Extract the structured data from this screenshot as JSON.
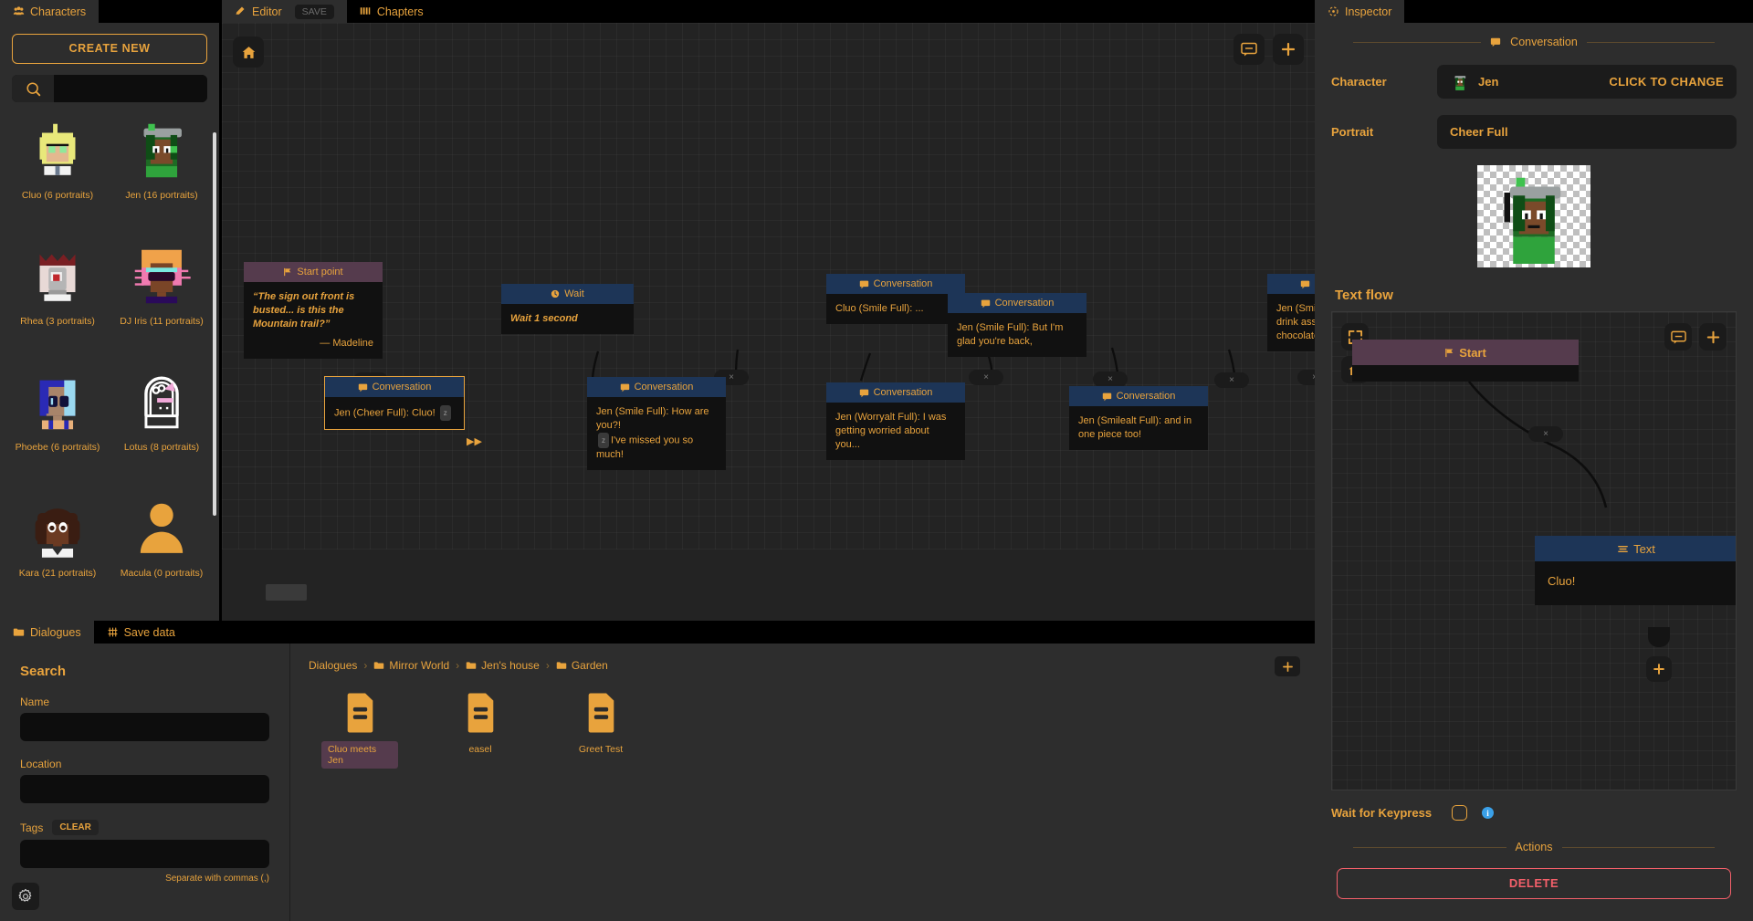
{
  "characters_panel": {
    "tab_label": "Characters",
    "create_new_label": "CREATE NEW",
    "search_placeholder": "",
    "search_value": "",
    "items": [
      {
        "label": "Cluo (6 portraits)",
        "name": "Cluo",
        "portraits": 6,
        "icon": "character-thumb-cluo"
      },
      {
        "label": "Jen (16 portraits)",
        "name": "Jen",
        "portraits": 16,
        "icon": "character-thumb-jen"
      },
      {
        "label": "Rhea (3 portraits)",
        "name": "Rhea",
        "portraits": 3,
        "icon": "character-thumb-rhea"
      },
      {
        "label": "DJ Iris (11 portraits)",
        "name": "DJ Iris",
        "portraits": 11,
        "icon": "character-thumb-dj-iris"
      },
      {
        "label": "Phoebe (6 portraits)",
        "name": "Phoebe",
        "portraits": 6,
        "icon": "character-thumb-phoebe"
      },
      {
        "label": "Lotus (8 portraits)",
        "name": "Lotus",
        "portraits": 8,
        "icon": "character-thumb-lotus"
      },
      {
        "label": "Kara (21 portraits)",
        "name": "Kara",
        "portraits": 21,
        "icon": "character-thumb-kara"
      },
      {
        "label": "Macula (0 portraits)",
        "name": "Macula",
        "portraits": 0,
        "icon": "character-thumb-macula"
      }
    ]
  },
  "editor": {
    "tabs": [
      {
        "label": "Editor",
        "icon": "pencil-icon",
        "active": true
      },
      {
        "label": "Chapters",
        "icon": "columns-icon",
        "active": false
      }
    ],
    "save_label": "SAVE",
    "home_icon": "home-icon",
    "toolbar_icons": [
      "comment-add-icon",
      "plus-icon"
    ],
    "nodes": [
      {
        "type": "Start point",
        "header_icon": "flag-icon",
        "text": "“The sign out front is busted... is this the Mountain trail?”",
        "attribution": "— Madeline",
        "style": "start"
      },
      {
        "type": "Wait",
        "header_icon": "clock-icon",
        "text": "Wait 1 second",
        "style": "wait"
      },
      {
        "type": "Conversation",
        "header_icon": "speech-icon",
        "text": "Jen (Cheer Full): Cluo!",
        "chip": "z",
        "selected": true
      },
      {
        "type": "Conversation",
        "header_icon": "speech-icon",
        "text": "Jen (Smile Full): How are you?!",
        "text2": "I've missed you so much!",
        "chip": "z"
      },
      {
        "type": "Conversation",
        "header_icon": "speech-icon",
        "text": "Cluo (Smile Full): ..."
      },
      {
        "type": "Conversation",
        "header_icon": "speech-icon",
        "text": "Jen (Worryalt Full): I was getting worried about you..."
      },
      {
        "type": "Conversation",
        "header_icon": "speech-icon",
        "text": "Jen (Smile Full): But I'm glad you're back,"
      },
      {
        "type": "Conversation",
        "header_icon": "speech-icon",
        "text": "Jen (Smilealt Full): and in one piece too!"
      },
      {
        "type": "Conversation",
        "header_icon": "speech-icon",
        "text": "Jen (Smile Full): go grab a drink assume you still chocolate."
      }
    ],
    "port_label": "×"
  },
  "bottom": {
    "tabs": [
      {
        "label": "Dialogues",
        "icon": "folder-icon",
        "active": true
      },
      {
        "label": "Save data",
        "icon": "grid-icon",
        "active": false
      }
    ],
    "search": {
      "title": "Search",
      "name_label": "Name",
      "name_value": "",
      "location_label": "Location",
      "location_value": "",
      "tags_label": "Tags",
      "tags_clear_label": "CLEAR",
      "tags_value": "",
      "tags_hint": "Separate with commas (,)",
      "settings_icon": "gear-icon"
    },
    "breadcrumb": [
      {
        "label": "Dialogues",
        "icon": null
      },
      {
        "label": "Mirror World",
        "icon": "folder-icon"
      },
      {
        "label": "Jen's house",
        "icon": "folder-icon"
      },
      {
        "label": "Garden",
        "icon": "folder-icon"
      }
    ],
    "breadcrumb_separator": "›",
    "files": [
      {
        "label": "Cluo meets Jen",
        "icon": "dialogue-file-icon",
        "selected": true
      },
      {
        "label": "easel",
        "icon": "dialogue-file-icon",
        "selected": false
      },
      {
        "label": "Greet Test",
        "icon": "dialogue-file-icon",
        "selected": false
      }
    ],
    "add_label": "+"
  },
  "inspector": {
    "tab_label": "Inspector",
    "tab_icon": "inspector-icon",
    "section_title": "Conversation",
    "section_icon": "speech-icon",
    "character_label": "Character",
    "character_value": "Jen",
    "character_action": "CLICK TO CHANGE",
    "portrait_label": "Portrait",
    "portrait_value": "Cheer Full",
    "textflow_title": "Text flow",
    "textflow": {
      "start_label": "Start",
      "start_icon": "flag-icon",
      "text_node_label": "Text",
      "text_node_icon": "lines-icon",
      "text_node_value": "Cluo!",
      "port_label": "×",
      "add_label": "+",
      "expand_icon": "expand-icon",
      "home_icon": "home-icon",
      "comment_icon": "comment-add-icon",
      "plus_icon": "plus-icon"
    },
    "keypress_label": "Wait for Keypress",
    "keypress_checked": false,
    "keypress_info_icon": "info-icon",
    "actions_title": "Actions",
    "delete_label": "DELETE"
  },
  "colors": {
    "accent": "#e8a33d",
    "panel": "#2d2d2d",
    "node_body": "#111111",
    "node_header": "#1d3557",
    "start_header": "#553b4d",
    "danger": "#f4606a",
    "info": "#3aa0e8"
  }
}
